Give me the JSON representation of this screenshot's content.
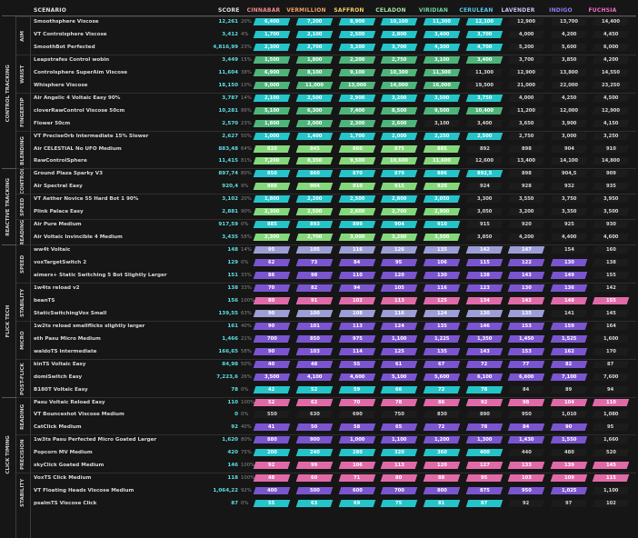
{
  "headers": {
    "scenario": "SCENARIO",
    "score": "SCORE",
    "ranks": [
      {
        "name": "CINNABAR",
        "color": "#f48a8a"
      },
      {
        "name": "VERMILLION",
        "color": "#f7a15f"
      },
      {
        "name": "SAFFRON",
        "color": "#f5d06a"
      },
      {
        "name": "CELADON",
        "color": "#a3e3a6"
      },
      {
        "name": "VIRIDIAN",
        "color": "#6fd7a4"
      },
      {
        "name": "CERULEAN",
        "color": "#5cc7ea"
      },
      {
        "name": "LAVENDER",
        "color": "#c9c0f2"
      },
      {
        "name": "INDIGO",
        "color": "#8e7ef0"
      },
      {
        "name": "FUCHSIA",
        "color": "#f26ec3"
      }
    ]
  },
  "sections": [
    {
      "name": "CONTROL TRACKING",
      "start": 0,
      "end": 11
    },
    {
      "name": "REACTIVE TRACKING",
      "start": 12,
      "end": 17
    },
    {
      "name": "FLICK TECH",
      "start": 18,
      "end": 29
    },
    {
      "name": "CLICK TIMING",
      "start": 30,
      "end": 38
    }
  ],
  "groups": [
    {
      "name": "AIM",
      "start": 0,
      "end": 2
    },
    {
      "name": "WRIST",
      "start": 3,
      "end": 5
    },
    {
      "name": "FINGERTIP",
      "start": 6,
      "end": 8
    },
    {
      "name": "BLENDING",
      "start": 9,
      "end": 11
    },
    {
      "name": "CONTROL",
      "start": 12,
      "end": 13
    },
    {
      "name": "SPEED",
      "start": 14,
      "end": 15
    },
    {
      "name": "READING",
      "start": 16,
      "end": 17
    },
    {
      "name": "SPEED",
      "start": 18,
      "end": 20
    },
    {
      "name": "STABILITY",
      "start": 21,
      "end": 23
    },
    {
      "name": "MICRO",
      "start": 24,
      "end": 26
    },
    {
      "name": "POST-FLICK",
      "start": 27,
      "end": 29
    },
    {
      "name": "READING",
      "start": 30,
      "end": 32
    },
    {
      "name": "PRECISION",
      "start": 33,
      "end": 35
    },
    {
      "name": "STABILITY",
      "start": 36,
      "end": 38
    }
  ],
  "rows": [
    {
      "name": "Smoothsphere Viscose",
      "score": "12,261",
      "pct": "20%",
      "cells": [
        "6,400",
        "7,200",
        "8,900",
        "10,100",
        "11,300",
        "12,100",
        "12,900",
        "13,700",
        "14,400"
      ]
    },
    {
      "name": "VT Controlsphere Viscose",
      "score": "3,412",
      "pct": "4%",
      "cells": [
        "1,700",
        "2,100",
        "2,500",
        "2,800",
        "3,400",
        "3,700",
        "4,000",
        "4,200",
        "4,450"
      ]
    },
    {
      "name": "SmoothBot Perfected",
      "score": "4,816,99",
      "pct": "23%",
      "cells": [
        "2,300",
        "2,700",
        "3,200",
        "3,700",
        "4,300",
        "4,700",
        "5,200",
        "5,600",
        "6,000"
      ]
    },
    {
      "name": "Leapstrafes Control wobin",
      "score": "3,449",
      "pct": "15%",
      "cells": [
        "1,500",
        "1,800",
        "2,200",
        "2,750",
        "3,100",
        "3,400",
        "3,700",
        "3,850",
        "4,200"
      ]
    },
    {
      "name": "Controlsphere SuperAim Viscose",
      "score": "11,604",
      "pct": "38%",
      "cells": [
        "6,900",
        "8,100",
        "9,100",
        "10,300",
        "11,300",
        "11,300",
        "12,900",
        "13,800",
        "14,550"
      ]
    },
    {
      "name": "Whisphere Viscose",
      "score": "18,150",
      "pct": "10%",
      "cells": [
        "9,000",
        "11,000",
        "13,000",
        "14,000",
        "16,000",
        "19,500",
        "21,000",
        "22,000",
        "23,250"
      ]
    },
    {
      "name": "Air Angelic 4 Voltaic Easy 90%",
      "score": "3,787",
      "pct": "14%",
      "cells": [
        "2,100",
        "2,500",
        "2,900",
        "3,200",
        "3,500",
        "3,750",
        "4,000",
        "4,250",
        "4,500"
      ]
    },
    {
      "name": "cloverRawControl Viscose 50cm",
      "score": "10,281",
      "pct": "86%",
      "cells": [
        "5,100",
        "6,300",
        "7,400",
        "8,500",
        "9,500",
        "10,400",
        "11,200",
        "12,000",
        "12,900"
      ]
    },
    {
      "name": "Flower 50cm",
      "score": "2,570",
      "pct": "23%",
      "cells": [
        "1,800",
        "2,000",
        "2,300",
        "2,600",
        "3,100",
        "3,400",
        "3,650",
        "3,900",
        "4,150"
      ]
    },
    {
      "name": "VT PreciseOrb Intermediate 15% Slower",
      "score": "2,627",
      "pct": "50%",
      "cells": [
        "1,000",
        "1,400",
        "1,700",
        "2,000",
        "2,250",
        "2,500",
        "2,750",
        "3,000",
        "3,250"
      ]
    },
    {
      "name": "Air CELESTIAL No UFO Medium",
      "score": "883,48",
      "pct": "64%",
      "cells": [
        "820",
        "845",
        "860",
        "875",
        "885",
        "892",
        "898",
        "904",
        "910"
      ]
    },
    {
      "name": "RawControlSphere",
      "score": "11,415",
      "pct": "81%",
      "cells": [
        "7,200",
        "8,350",
        "9,500",
        "10,600",
        "11,600",
        "12,600",
        "13,400",
        "14,100",
        "14,800"
      ]
    },
    {
      "name": "Ground Plaza Sparky V3",
      "score": "897,74",
      "pct": "80%",
      "cells": [
        "850",
        "860",
        "870",
        "879",
        "886",
        "892,5",
        "898",
        "904,5",
        "909"
      ]
    },
    {
      "name": "Air Spectral Easy",
      "score": "920,4",
      "pct": "9%",
      "cells": [
        "888",
        "904",
        "910",
        "915",
        "920",
        "924",
        "928",
        "932",
        "935"
      ]
    },
    {
      "name": "VT Aether Novice 55 Hard Bot 1 90%",
      "score": "3,102",
      "pct": "20%",
      "cells": [
        "1,800",
        "2,200",
        "2,500",
        "2,800",
        "3,050",
        "3,300",
        "3,550",
        "3,750",
        "3,950"
      ]
    },
    {
      "name": "Plink Palace Easy",
      "score": "2,881",
      "pct": "90%",
      "cells": [
        "2,300",
        "2,500",
        "2,600",
        "2,700",
        "2,900",
        "3,050",
        "3,200",
        "3,350",
        "3,500"
      ]
    },
    {
      "name": "Air Pure Medium",
      "score": "917,59",
      "pct": "0%",
      "cells": [
        "885",
        "893",
        "899",
        "904",
        "910",
        "915",
        "920",
        "925",
        "930"
      ]
    },
    {
      "name": "Air Voltaic Invincible 4 Medium",
      "score": "3,435",
      "pct": "58%",
      "cells": [
        "2,300",
        "2,700",
        "3,000",
        "3,200",
        "3,500",
        "3,850",
        "4,200",
        "4,400",
        "4,600"
      ]
    },
    {
      "name": "ww4t Voltaic",
      "score": "148",
      "pct": "14%",
      "cells": [
        "95",
        "105",
        "116",
        "126",
        "135",
        "142",
        "147",
        "154",
        "160"
      ]
    },
    {
      "name": "voxTargetSwitch 2",
      "score": "129",
      "pct": "0%",
      "cells": [
        "62",
        "73",
        "84",
        "95",
        "106",
        "115",
        "122",
        "130",
        "138"
      ]
    },
    {
      "name": "aimers+ Static Switching 5 Bot Slightly Larger",
      "score": "151",
      "pct": "33%",
      "cells": [
        "86",
        "98",
        "110",
        "120",
        "130",
        "138",
        "143",
        "149",
        "155"
      ]
    },
    {
      "name": "1w4ts reload v2",
      "score": "138",
      "pct": "33%",
      "cells": [
        "70",
        "82",
        "94",
        "105",
        "116",
        "123",
        "130",
        "136",
        "142"
      ]
    },
    {
      "name": "beanTS",
      "score": "156",
      "pct": "100%",
      "cells": [
        "80",
        "91",
        "102",
        "113",
        "125",
        "134",
        "142",
        "148",
        "155"
      ]
    },
    {
      "name": "StaticSwitchingVox Small",
      "score": "139,55",
      "pct": "63%",
      "cells": [
        "90",
        "100",
        "108",
        "116",
        "124",
        "130",
        "135",
        "141",
        "145"
      ]
    },
    {
      "name": "1w2ts reload smallflicks slightly larger",
      "score": "161",
      "pct": "40%",
      "cells": [
        "90",
        "101",
        "113",
        "124",
        "135",
        "146",
        "153",
        "159",
        "164"
      ]
    },
    {
      "name": "eth Pasu Micro Medium",
      "score": "1,466",
      "pct": "21%",
      "cells": [
        "700",
        "850",
        "975",
        "1,100",
        "1,225",
        "1,350",
        "1,450",
        "1,525",
        "1,600"
      ]
    },
    {
      "name": "waldoTS intermediate",
      "score": "166,65",
      "pct": "58%",
      "cells": [
        "90",
        "103",
        "114",
        "125",
        "135",
        "143",
        "153",
        "162",
        "170"
      ]
    },
    {
      "name": "kinTS Voltaic Easy",
      "score": "84,98",
      "pct": "50%",
      "cells": [
        "40",
        "48",
        "55",
        "61",
        "67",
        "72",
        "77",
        "82",
        "87"
      ]
    },
    {
      "name": "domiSwitch Easy",
      "score": "7,223,6",
      "pct": "26%",
      "cells": [
        "3,500",
        "4,100",
        "4,600",
        "5,100",
        "5,600",
        "6,100",
        "6,600",
        "7,100",
        "7,600"
      ]
    },
    {
      "name": "B180T Voltaic Easy",
      "score": "78",
      "pct": "0%",
      "cells": [
        "42",
        "52",
        "59",
        "66",
        "72",
        "78",
        "84",
        "89",
        "94"
      ]
    },
    {
      "name": "Pasu Voltaic Reload Easy",
      "score": "110",
      "pct": "100%",
      "cells": [
        "52",
        "62",
        "70",
        "78",
        "86",
        "92",
        "98",
        "104",
        "110"
      ]
    },
    {
      "name": "VT Bounceshot Viscose Medium",
      "score": "0",
      "pct": "0%",
      "cells": [
        "550",
        "630",
        "690",
        "750",
        "830",
        "890",
        "950",
        "1,010",
        "1,080"
      ]
    },
    {
      "name": "CatClick Medium",
      "score": "92",
      "pct": "40%",
      "cells": [
        "41",
        "50",
        "58",
        "65",
        "72",
        "78",
        "84",
        "90",
        "95"
      ]
    },
    {
      "name": "1w3ts Pasu Perfected Micro Goated Larger",
      "score": "1,620",
      "pct": "80%",
      "cells": [
        "880",
        "900",
        "1,000",
        "1,100",
        "1,200",
        "1,300",
        "1,430",
        "1,550",
        "1,660"
      ]
    },
    {
      "name": "Popcorn MV Medium",
      "score": "420",
      "pct": "75%",
      "cells": [
        "200",
        "240",
        "280",
        "320",
        "360",
        "400",
        "440",
        "480",
        "520"
      ]
    },
    {
      "name": "skyClick Goated Medium",
      "score": "146",
      "pct": "100%",
      "cells": [
        "92",
        "99",
        "106",
        "113",
        "120",
        "127",
        "133",
        "139",
        "145"
      ]
    },
    {
      "name": "VoxTS Click Medium",
      "score": "118",
      "pct": "100%",
      "cells": [
        "48",
        "60",
        "71",
        "80",
        "88",
        "95",
        "103",
        "109",
        "115"
      ]
    },
    {
      "name": "VT Floating Heads Viscose Medium",
      "score": "1,064,22",
      "pct": "92%",
      "cells": [
        "400",
        "500",
        "600",
        "700",
        "800",
        "875",
        "950",
        "1,025",
        "1,100"
      ]
    },
    {
      "name": "psalmTS Viscose Click",
      "score": "87",
      "pct": "0%",
      "cells": [
        "55",
        "63",
        "69",
        "75",
        "81",
        "87",
        "92",
        "97",
        "102"
      ]
    }
  ],
  "fills": [
    {
      "color": "#24c4c9",
      "count": 6
    },
    {
      "color": "#24c4c9",
      "count": 6
    },
    {
      "color": "#24c4c9",
      "count": 6
    },
    {
      "color": "#4fb47a",
      "count": 6
    },
    {
      "color": "#4fb47a",
      "count": 5
    },
    {
      "color": "#4fb47a",
      "count": 5
    },
    {
      "color": "#24c4c9",
      "count": 6
    },
    {
      "color": "#4fb47a",
      "count": 6
    },
    {
      "color": "#4fb47a",
      "count": 4
    },
    {
      "color": "#24c4c9",
      "count": 6
    },
    {
      "color": "#84d87b",
      "count": 5
    },
    {
      "color": "#84d87b",
      "count": 5
    },
    {
      "color": "#24c4c9",
      "count": 6
    },
    {
      "color": "#84d87b",
      "count": 5
    },
    {
      "color": "#24c4c9",
      "count": 5
    },
    {
      "color": "#84d87b",
      "count": 5
    },
    {
      "color": "#24c4c9",
      "count": 5
    },
    {
      "color": "#84d87b",
      "count": 5
    },
    {
      "color": "#9d9ed6",
      "count": 7
    },
    {
      "color": "#7a55cf",
      "count": 8
    },
    {
      "color": "#7a55cf",
      "count": 8
    },
    {
      "color": "#7a55cf",
      "count": 8
    },
    {
      "color": "#e06aa8",
      "count": 9
    },
    {
      "color": "#9d9ed6",
      "count": 7
    },
    {
      "color": "#7a55cf",
      "count": 8
    },
    {
      "color": "#7a55cf",
      "count": 8
    },
    {
      "color": "#7a55cf",
      "count": 8
    },
    {
      "color": "#7a55cf",
      "count": 8
    },
    {
      "color": "#7a55cf",
      "count": 8
    },
    {
      "color": "#24c4c9",
      "count": 6
    },
    {
      "color": "#e06aa8",
      "count": 9
    },
    {
      "color": "#7a55cf",
      "count": 0
    },
    {
      "color": "#7a55cf",
      "count": 8
    },
    {
      "color": "#7a55cf",
      "count": 8
    },
    {
      "color": "#24c4c9",
      "count": 6
    },
    {
      "color": "#e06aa8",
      "count": 9
    },
    {
      "color": "#e06aa8",
      "count": 9
    },
    {
      "color": "#7a55cf",
      "count": 8
    },
    {
      "color": "#24c4c9",
      "count": 6
    }
  ],
  "scoreColors": {
    "default": "#5ee0e5"
  }
}
